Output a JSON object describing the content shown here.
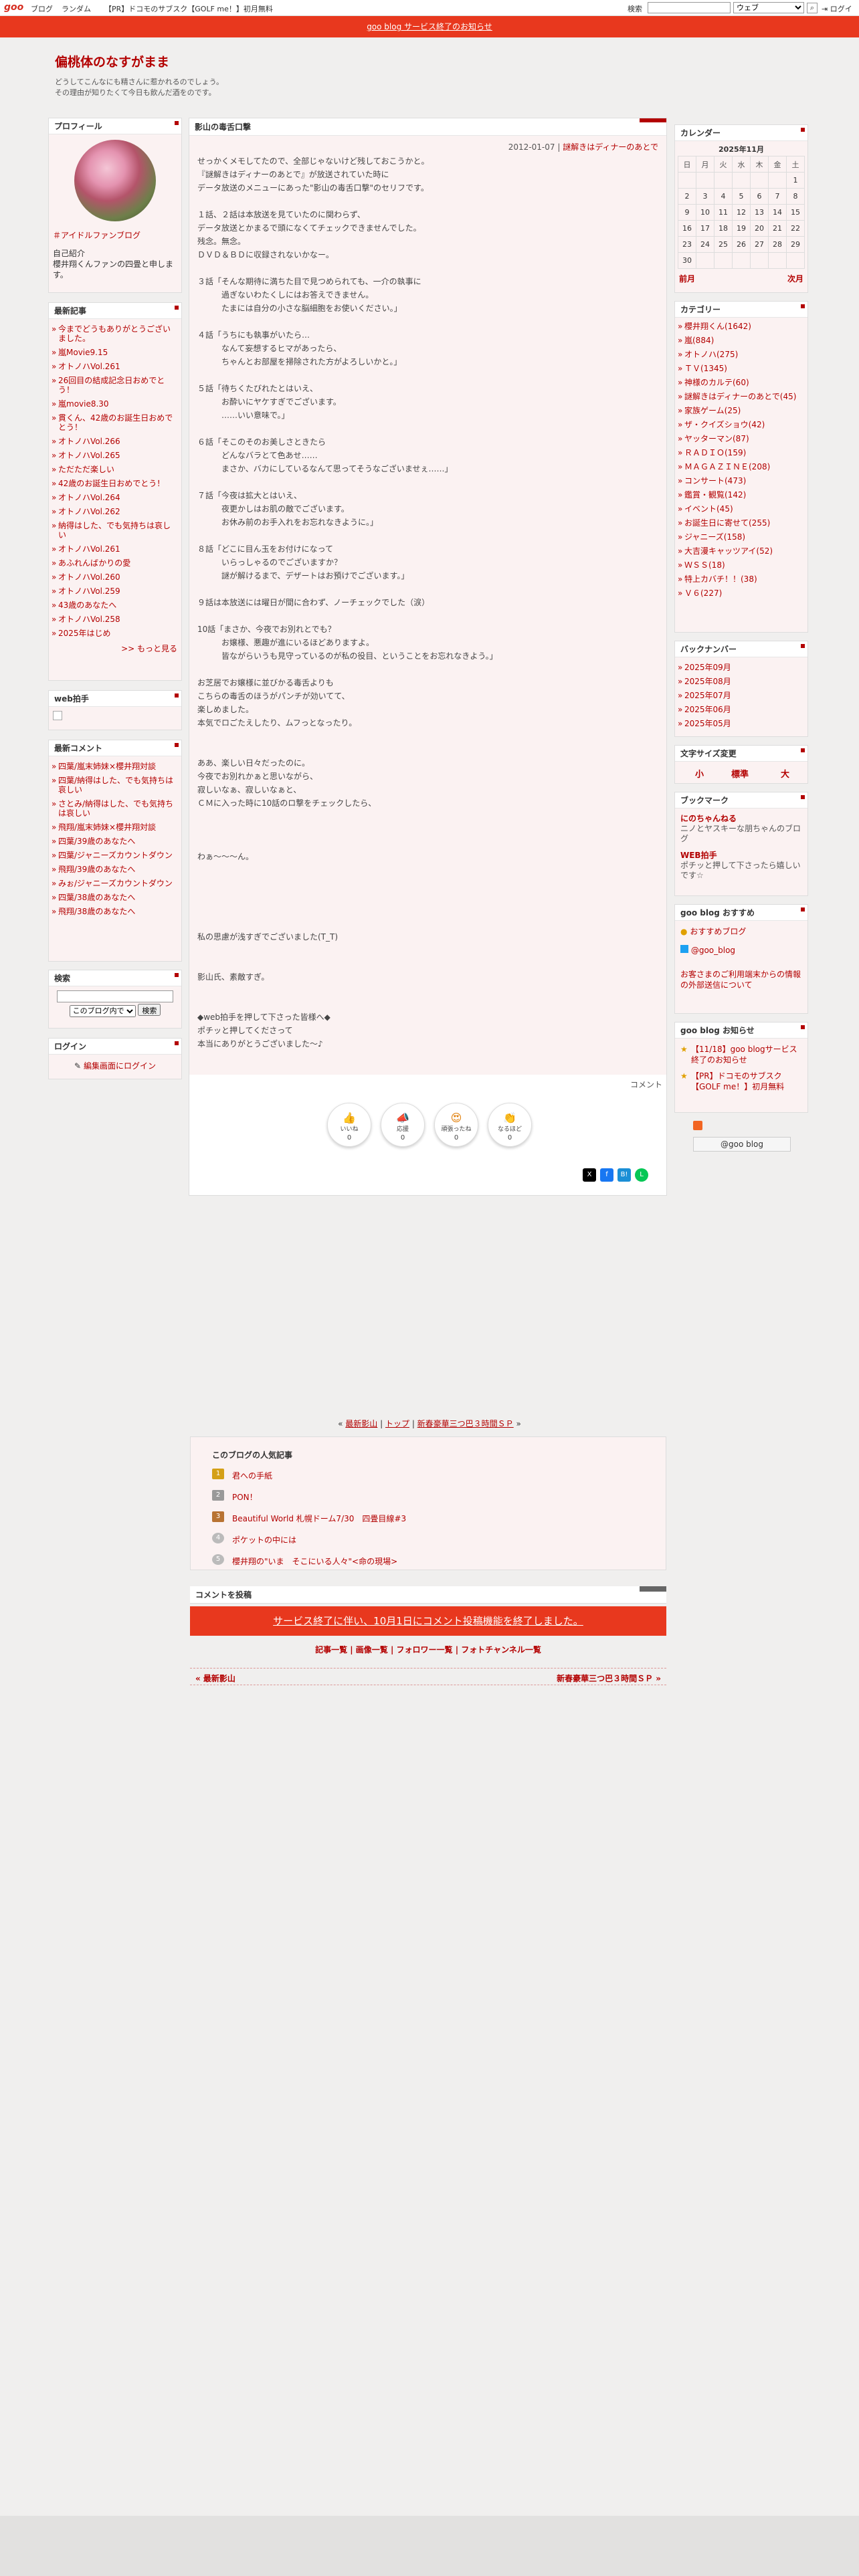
{
  "gbar": {
    "logo": "goo",
    "links": [
      "ブログ",
      "ランダム"
    ],
    "promo": "【PR】ドコモのサブスク【GOLF me！】初月無料",
    "search_label": "検索",
    "search_select": "ウェブ",
    "login": "ログイン"
  },
  "notice": "goo blog サービス終了のお知らせ",
  "blog": {
    "title": "偏桃体のなすがまま",
    "desc1": "どうしてこんなにも精さんに惹かれるのでしょう。",
    "desc2": "その理由が知りたくて今日も飲んだ酒をのです。"
  },
  "profile": {
    "heading": "プロフィール",
    "link": "＃アイドルファンブログ",
    "intro_label": "自己紹介",
    "intro": "櫻井翔くんファンの四畳と申します。"
  },
  "recent": {
    "heading": "最新記事",
    "items": [
      "今までどうもありがとうございました。",
      "嵐Movie9.15",
      "オトノハVol.261",
      "26回目の結成記念日おめでとう！",
      "嵐movie8.30",
      "貫くん、42歳のお誕生日おめでとう！",
      "オトノハVol.266",
      "オトノハVol.265",
      "ただただ楽しい",
      "42歳のお誕生日おめでとう！",
      "オトノハVol.264",
      "オトノハVol.262",
      "納得はした、でも気持ちは哀しい",
      "オトノハVol.261",
      "あふれんばかりの愛",
      "オトノハVol.260",
      "オトノハVol.259",
      "43歳のあなたへ",
      "オトノハVol.258",
      "2025年はじめ"
    ],
    "more": ">> もっと見る"
  },
  "webclap": {
    "heading": "web拍手"
  },
  "recent_comments": {
    "heading": "最新コメント",
    "items": [
      "四葉/嵐末姉妹×櫻井翔対談",
      "四葉/納得はした、でも気持ちは哀しい",
      "さとみ/納得はした、でも気持ちは哀しい",
      "飛翔/嵐末姉妹×櫻井翔対談",
      "四葉/39歳のあなたへ",
      "四葉/ジャニーズカウントダウン",
      "飛翔/39歳のあなたへ",
      "みぉ/ジャニーズカウントダウン",
      "四葉/38歳のあなたへ",
      "飛翔/38歳のあなたへ"
    ]
  },
  "search_box": {
    "heading": "検索",
    "select": "このブログ内で",
    "button": "検索"
  },
  "login_box": {
    "heading": "ログイン",
    "link": "編集画面にログイン"
  },
  "post": {
    "heading": "影山の毒舌口撃",
    "date": "2012-01-07",
    "category": "謎解きはディナーのあとで",
    "body1": "せっかくメモしてたので、全部じゃないけど残しておこうかと。\n『謎解きはディナーのあとで』が放送されていた時に\nデータ放送のメニューにあった\"影山の毒舌口撃\"のセリフです。\n\n１話、２話は本放送を見ていたのに関わらず、\nデータ放送とかまるで頭になくてチェックできませんでした。\n残念。無念。\nＤＶＤ＆ＢＤに収録されないかなー。\n\n３話「そんな期待に満ちた目で見つめられても、一介の執事に\n　　　過ぎないわたくしにはお答えできません。\n　　　たまには自分の小さな脳細胞をお使いください。」\n\n４話「うちにも執事がいたら…\n　　　なんて妄想するヒマがあったら、\n　　　ちゃんとお部屋を掃除された方がよろしいかと。」\n\n５話「待ちくたびれたとはいえ、\n　　　お酔いにヤケすぎでございます。\n　　　……いい意味で。」\n\n６話「そこのそのお美しさときたら\n　　　どんなバラとて色あせ……\n　　　まさか、バカにしているなんて思ってそうなございませぇ……」\n\n７話「今夜は拡大とはいえ、\n　　　夜更かしはお肌の敵でございます。\n　　　お休み前のお手入れをお忘れなきように。」\n\n８話「どこに目ん玉をお付けになって\n　　　いらっしゃるのでございますか？\n　　　謎が解けるまで、デザートはお預けでございます。」\n\n９話は本放送には曜日が間に合わず、ノーチェックでした（涙）\n\n10話「まさか、今夜でお別れとでも？\n　　　お嬢様、悪趣が進にいるほどありますよ。\n　　　皆ながらいうも見守っているのが私の役目、ということをお忘れなきよう。」",
    "body2": "お芝居でお嬢様に並びかる毒舌よりも\nこちらの毒舌のほうがパンチが効いてて、\n楽しめました。\n本気でロごたえしたり、ムフっとなったり。\n\n\nああ、楽しい日々だったのに。\n今夜でお別れかぁと思いながら、\n寂しいなぁ、寂しいなぁと、\nＣＭに入った時に10話のロ撃をチェックしたら、\n\n\n\nわぁ〜〜〜ん。\n\n\n\n\n\n私の思慮が浅すぎでございました(T_T)\n\n\n影山氏、素敵すぎ。\n\n\n◆web拍手を押して下さった皆様へ◆\nポチッと押してくださって\n本当にありがとうございました〜♪",
    "comment_link": "コメント",
    "reactions": [
      {
        "label": "いいね",
        "count": "0",
        "icon": "👍"
      },
      {
        "label": "応援",
        "count": "0",
        "icon": "📣"
      },
      {
        "label": "頑張ったね",
        "count": "0",
        "icon": "😍"
      },
      {
        "label": "なるほど",
        "count": "0",
        "icon": "👏"
      }
    ],
    "share": [
      "X",
      "f",
      "B!",
      "L"
    ]
  },
  "nav": {
    "prev": "最新影山",
    "top": "トップ",
    "next": "新春豪華三つ巴３時間ＳＰ"
  },
  "popular": {
    "heading": "このブログの人気記事",
    "items": [
      "君への手紙",
      "PON！",
      "Beautiful World 札幌ドーム7/30　四畳目線#3",
      "ポケットの中には",
      "櫻井翔の\"いま　そこにいる人々\"<命の現場>"
    ]
  },
  "comment_post": {
    "heading": "コメントを投稿",
    "notice": "サービス終了に伴い、10月1日にコメント投稿機能を終了しました。"
  },
  "bottom_links": "記事一覧 | 画像一覧 | フォロワー一覧 | フォトチャンネル一覧",
  "prevnext": {
    "prev": "« 最新影山",
    "next": "新春豪華三つ巴３時間ＳＰ »"
  },
  "calendar": {
    "heading": "カレンダー",
    "month": "2025年11月",
    "days": [
      "日",
      "月",
      "火",
      "水",
      "木",
      "金",
      "土"
    ],
    "weeks": [
      [
        "",
        "",
        "",
        "",
        "",
        "",
        "1"
      ],
      [
        "2",
        "3",
        "4",
        "5",
        "6",
        "7",
        "8"
      ],
      [
        "9",
        "10",
        "11",
        "12",
        "13",
        "14",
        "15"
      ],
      [
        "16",
        "17",
        "18",
        "19",
        "20",
        "21",
        "22"
      ],
      [
        "23",
        "24",
        "25",
        "26",
        "27",
        "28",
        "29"
      ],
      [
        "30",
        "",
        "",
        "",
        "",
        "",
        ""
      ]
    ],
    "prev": "前月",
    "next": "次月"
  },
  "categories": {
    "heading": "カテゴリー",
    "items": [
      "櫻井翔くん(1642)",
      "嵐(884)",
      "オトノハ(275)",
      "ＴＶ(1345)",
      "神様のカルテ(60)",
      "謎解きはディナーのあとで(45)",
      "家族ゲーム(25)",
      "ザ・クイズショウ(42)",
      "ヤッターマン(87)",
      "ＲＡＤＩＯ(159)",
      "ＭＡＧＡＺＩＮＥ(208)",
      "コンサート(473)",
      "鑑賞・観覧(142)",
      "イベント(45)",
      "お誕生日に寄せて(255)",
      "ジャニーズ(158)",
      "大吉漫キャッツアイ(52)",
      "ＷＳＳ(18)",
      "特上カバチ！！(38)",
      "Ｖ６(227)"
    ]
  },
  "backnumber": {
    "heading": "バックナンバー",
    "items": [
      "2025年09月",
      "2025年08月",
      "2025年07月",
      "2025年06月",
      "2025年05月"
    ]
  },
  "fontsize": {
    "heading": "文字サイズ変更",
    "small": "小",
    "normal": "標準",
    "large": "大"
  },
  "bookmark": {
    "heading": "ブックマーク",
    "items": [
      {
        "title": "にのちゃんねる",
        "desc": "ニノとヤスキーな朋ちゃんのブログ"
      },
      {
        "title": "WEB拍手",
        "desc": "ポチッと押して下さったら嬉しいです☆"
      }
    ]
  },
  "goo_recommend": {
    "heading": "goo blog おすすめ",
    "link1": "おすすめブログ",
    "link2": "@goo_blog",
    "link3": "お客さまのご利用端末からの情報の外部送信について"
  },
  "goo_news": {
    "heading": "goo blog お知らせ",
    "items": [
      "【11/18】goo blogサービス終了のお知らせ",
      "【PR】ドコモのサブスク【GOLF me！】初月無料"
    ]
  },
  "goo_badge": "@goo blog",
  "colors": {
    "accent": "#b30000",
    "notice_bar": "#e8381e",
    "panel_bg": "#fbf2f2"
  }
}
